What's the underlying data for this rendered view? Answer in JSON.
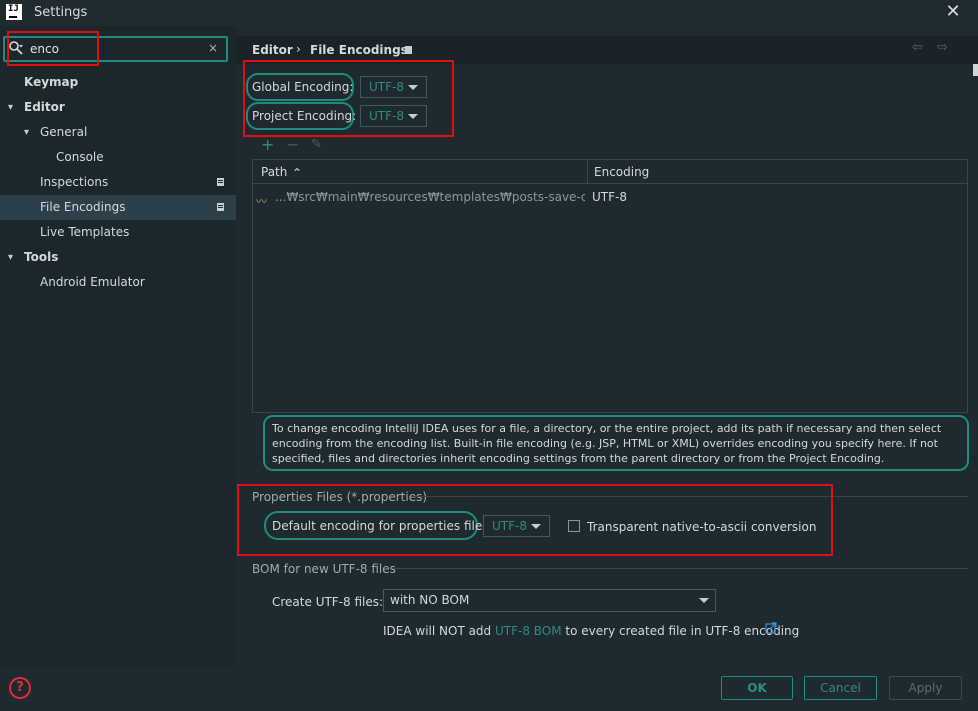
{
  "window": {
    "title": "Settings",
    "app_icon_text": "IJ",
    "close_glyph": "✕"
  },
  "search": {
    "value": "enco",
    "clear_glyph": "×"
  },
  "sidebar": {
    "items": [
      {
        "label": "Keymap",
        "level": 0,
        "bold": true,
        "expanded": null
      },
      {
        "label": "Editor",
        "level": 0,
        "bold": true,
        "expanded": true
      },
      {
        "label": "General",
        "level": 1,
        "bold": false,
        "expanded": true
      },
      {
        "label": "Console",
        "level": 2,
        "bold": false,
        "expanded": null
      },
      {
        "label": "Inspections",
        "level": 1,
        "bold": false,
        "expanded": null
      },
      {
        "label": "File Encodings",
        "level": 1,
        "bold": false,
        "expanded": null,
        "selected": true
      },
      {
        "label": "Live Templates",
        "level": 1,
        "bold": false,
        "expanded": null
      },
      {
        "label": "Tools",
        "level": 0,
        "bold": true,
        "expanded": true
      },
      {
        "label": "Android Emulator",
        "level": 1,
        "bold": false,
        "expanded": null
      }
    ]
  },
  "breadcrumb": {
    "parent": "Editor",
    "separator": "›",
    "current": "File Encodings",
    "back_glyph": "🡐",
    "forward_glyph": "🡒"
  },
  "encoding": {
    "global_label": "Global Encoding:",
    "global_value": "UTF-8",
    "project_label": "Project Encoding:",
    "project_value": "UTF-8"
  },
  "table": {
    "toolbar": {
      "add": "+",
      "remove": "−",
      "edit": "✎"
    },
    "columns": [
      "Path",
      "Encoding"
    ],
    "sort_glyph": "⌃",
    "rows": [
      {
        "path": "...₩src₩main₩resources₩templates₩posts-save-comparis",
        "encoding": "UTF-8"
      }
    ]
  },
  "info_text": "To change encoding IntelliJ IDEA uses for a file, a directory, or the entire project, add its path if necessary and then select encoding from the encoding list. Built-in file encoding (e.g. JSP, HTML or XML) overrides encoding you specify here. If not specified, files and directories inherit encoding settings from the parent directory or from the Project Encoding.",
  "properties": {
    "section_title": "Properties Files (*.properties)",
    "default_label": "Default encoding for properties files:",
    "default_value": "UTF-8",
    "transparent_label": "Transparent native-to-ascii conversion",
    "transparent_checked": false
  },
  "bom": {
    "section_title": "BOM for new UTF-8 files",
    "create_label": "Create UTF-8 files:",
    "create_value": "with NO BOM",
    "note_prefix": "IDEA will NOT add ",
    "note_link": "UTF-8 BOM",
    "note_suffix": " to every created file in UTF-8 encoding"
  },
  "buttons": {
    "help": "?",
    "ok": "OK",
    "cancel": "Cancel",
    "apply": "Apply"
  },
  "colors": {
    "accent": "#1e8c80",
    "highlight_red": "#e01010",
    "background": "#1e2a2f",
    "selected": "#2d4049"
  }
}
